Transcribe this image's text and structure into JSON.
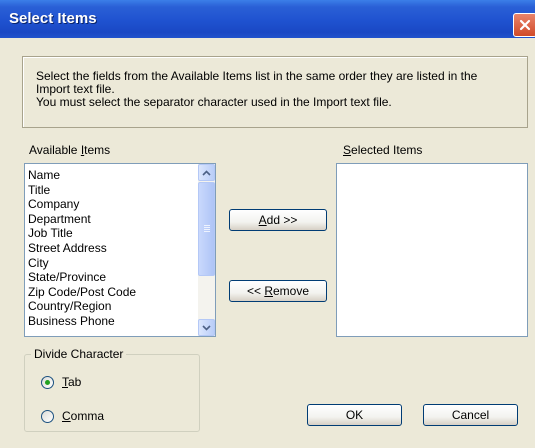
{
  "window": {
    "title": "Select Items"
  },
  "info": {
    "line1": "Select the fields from the Available Items list in the same order they are listed in the",
    "line2": "Import text file.",
    "line3": "You must select the separator character used in the Import text file."
  },
  "available": {
    "label": "Available Items",
    "items": [
      "Name",
      "Title",
      "Company",
      "Department",
      "Job Title",
      "Street Address",
      "City",
      "State/Province",
      "Zip Code/Post Code",
      "Country/Region",
      "Business Phone"
    ],
    "scroll_position": 0
  },
  "selected": {
    "label": "Selected Items",
    "items": []
  },
  "buttons": {
    "add": "Add >>",
    "remove": "<< Remove",
    "ok": "OK",
    "cancel": "Cancel"
  },
  "divide": {
    "label": "Divide Character",
    "options": [
      {
        "label": "Tab",
        "selected": true
      },
      {
        "label": "Comma",
        "selected": false
      }
    ]
  },
  "colors": {
    "titlebar": "#1f52d0",
    "background": "#ece9d8",
    "close_button": "#d04a28"
  }
}
